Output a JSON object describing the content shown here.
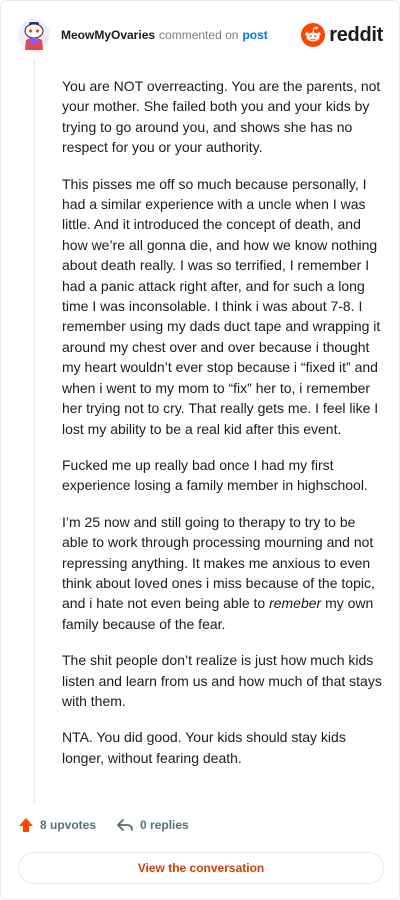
{
  "comment": {
    "username": "MeowMyOvaries",
    "action_text": "commented on",
    "link_text": "post",
    "paragraphs": [
      "You are NOT overreacting. You are the parents, not your mother. She failed both you and your kids by trying to go around you, and shows she has no respect for you or your authority.",
      "This pisses me off so much because personally, I had a similar experience with a uncle when I was little. And it introduced the concept of death, and how we’re all gonna die, and how we know nothing about death really. I was so terrified, I remember I had a panic attack right after, and for such a long time I was inconsolable. I think i was about 7-8. I remember using my dads duct tape and wrapping it around my chest over and over because i thought my heart wouldn’t ever stop because i “fixed it” and when i went to my mom to “fix” her to, i remember her trying not to cry. That really gets me. I feel like I lost my ability to be a real kid after this event.",
      "Fucked me up really bad once I had my first experience losing a family member in highschool.",
      "The shit people don’t realize is just how much kids listen and learn from us and how much of that stays with them.",
      "NTA. You did good. Your kids should stay kids longer, without fearing death."
    ],
    "therapy_paragraph": {
      "before": "I’m 25 now and still going to therapy to try to be able to work through processing mourning and not repressing anything. It makes me anxious to even think about loved ones i miss because of the topic, and i hate not even being able to ",
      "italic": "remeber",
      "after": " my own family because of the fear."
    },
    "upvotes_label": "8 upvotes",
    "replies_label": "0 replies"
  },
  "brand": {
    "name": "reddit",
    "color": "#ff4500"
  },
  "cta_label": "View the conversation",
  "icons": {
    "avatar": "snoo-avatar-icon",
    "upvote": "upvote-arrow-icon",
    "reply": "reply-arrow-icon",
    "logo": "reddit-snoo-icon"
  }
}
